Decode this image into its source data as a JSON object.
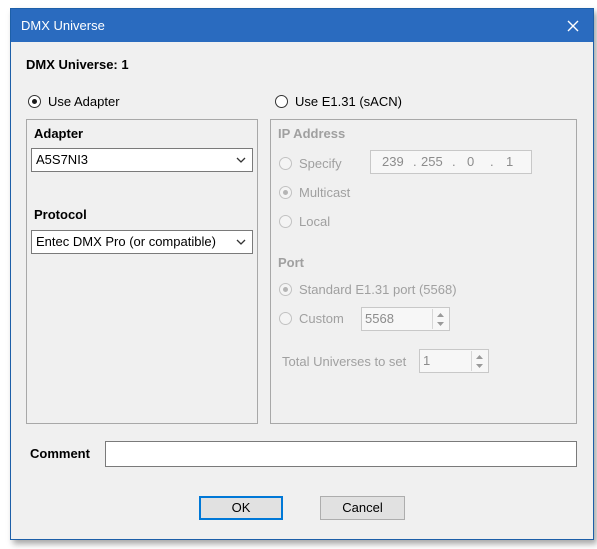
{
  "window": {
    "title": "DMX Universe"
  },
  "header": {
    "universe_label": "DMX Universe: 1"
  },
  "mode": {
    "use_adapter_label": "Use Adapter",
    "use_e131_label": "Use E1.31 (sACN)",
    "selected": "adapter"
  },
  "adapter": {
    "heading": "Adapter",
    "selected_value": "A5S7NI3",
    "protocol_heading": "Protocol",
    "protocol_value": "Entec DMX Pro (or compatible)"
  },
  "e131": {
    "ip_heading": "IP Address",
    "specify_label": "Specify",
    "ip_octets": [
      "239",
      "255",
      "0",
      "1"
    ],
    "multicast_label": "Multicast",
    "local_label": "Local",
    "ip_selected": "multicast",
    "port_heading": "Port",
    "standard_port_label": "Standard E1.31 port (5568)",
    "custom_label": "Custom",
    "custom_port_value": "5568",
    "port_selected": "standard",
    "total_universes_label": "Total Universes to set",
    "total_universes_value": "1"
  },
  "comment": {
    "label": "Comment",
    "value": ""
  },
  "buttons": {
    "ok_label": "OK",
    "cancel_label": "Cancel"
  },
  "colors": {
    "titlebar": "#2a6bbf",
    "default_button_border": "#0078d7"
  }
}
